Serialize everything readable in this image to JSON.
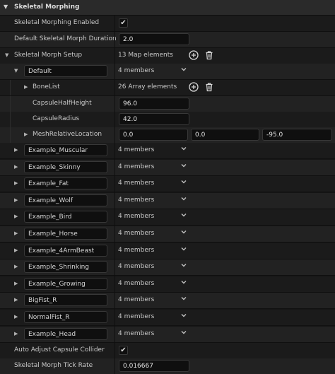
{
  "section": {
    "title": "Skeletal Morphing",
    "arrow": "▼"
  },
  "props": {
    "enabled_label": "Skeletal Morphing Enabled",
    "enabled_value": true,
    "duration_label": "Default Skeletal Morph Duration",
    "duration_value": "2.0",
    "setup_label": "Skeletal Morph Setup",
    "setup_value": "13 Map elements"
  },
  "default_entry": {
    "key": "Default",
    "members": "4 members",
    "bonelist_label": "BoneList",
    "bonelist_value": "26 Array elements",
    "half_height_label": "CapsuleHalfHeight",
    "half_height_value": "96.0",
    "radius_label": "CapsuleRadius",
    "radius_value": "42.0",
    "mesh_loc_label": "MeshRelativeLocation",
    "mesh_loc_x": "0.0",
    "mesh_loc_y": "0.0",
    "mesh_loc_z": "-95.0"
  },
  "entries": [
    {
      "key": "Example_Muscular",
      "members": "4 members"
    },
    {
      "key": "Example_Skinny",
      "members": "4 members"
    },
    {
      "key": "Example_Fat",
      "members": "4 members"
    },
    {
      "key": "Example_Wolf",
      "members": "4 members"
    },
    {
      "key": "Example_Bird",
      "members": "4 members"
    },
    {
      "key": "Example_Horse",
      "members": "4 members"
    },
    {
      "key": "Example_4ArmBeast",
      "members": "4 members"
    },
    {
      "key": "Example_Shrinking",
      "members": "4 members"
    },
    {
      "key": "Example_Growing",
      "members": "4 members"
    },
    {
      "key": "BigFist_R",
      "members": "4 members"
    },
    {
      "key": "NormalFist_R",
      "members": "4 members"
    },
    {
      "key": "Example_Head",
      "members": "4 members"
    }
  ],
  "footer": {
    "auto_adjust_label": "Auto Adjust Capsule Collider",
    "auto_adjust_value": true,
    "tick_label": "Skeletal Morph Tick Rate",
    "tick_value": "0.016667"
  },
  "icons": {
    "add": "add-circle-icon",
    "delete": "trash-icon",
    "check": "✔",
    "expanded": "▼",
    "collapsed": "▶",
    "chevron": "⌄"
  },
  "colors": {
    "background": "#151515",
    "header": "#2a2a2a",
    "text": "#c9c9c9"
  }
}
